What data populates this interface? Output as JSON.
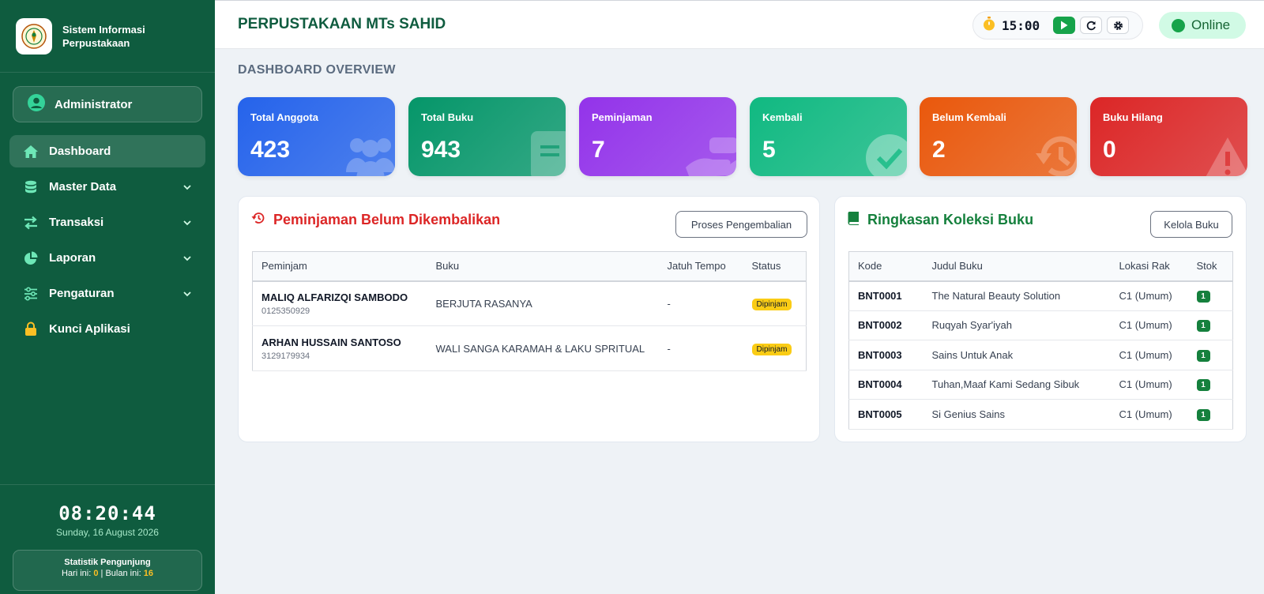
{
  "sidebar": {
    "brand": {
      "line1": "Sistem Informasi",
      "line2": "Perpustakaan"
    },
    "user": "Administrator",
    "menu": [
      {
        "label": "Dashboard",
        "icon": "home-icon",
        "active": true
      },
      {
        "label": "Master Data",
        "icon": "database-icon",
        "expandable": true
      },
      {
        "label": "Transaksi",
        "icon": "exchange-icon",
        "expandable": true
      },
      {
        "label": "Laporan",
        "icon": "pie-chart-icon",
        "expandable": true
      },
      {
        "label": "Pengaturan",
        "icon": "sliders-icon",
        "expandable": true
      },
      {
        "label": "Kunci Aplikasi",
        "icon": "lock-icon"
      }
    ],
    "clock": "08:20:44",
    "date": "Sunday, 16 August 2026",
    "visitor": {
      "title": "Statistik Pengunjung",
      "today_label": "Hari ini:",
      "today": "0",
      "month_label": "Bulan ini:",
      "month": "16"
    }
  },
  "header": {
    "title": "PERPUSTAKAAN MTs SAHID",
    "timer": "15:00",
    "status": "Online"
  },
  "main": {
    "section_title": "DASHBOARD OVERVIEW",
    "cards": [
      {
        "label": "Total Anggota",
        "value": "423",
        "color": "#2563eb"
      },
      {
        "label": "Total Buku",
        "value": "943",
        "color": "#059669"
      },
      {
        "label": "Peminjaman",
        "value": "7",
        "color": "#9333ea"
      },
      {
        "label": "Kembali",
        "value": "5",
        "color": "#10b981"
      },
      {
        "label": "Belum Kembali",
        "value": "2",
        "color": "#ea580c"
      },
      {
        "label": "Buku Hilang",
        "value": "0",
        "color": "#dc2626"
      }
    ],
    "loans": {
      "title": "Peminjaman Belum Dikembalikan",
      "button": "Proses Pengembalian",
      "columns": [
        "Peminjam",
        "Buku",
        "Jatuh Tempo",
        "Status"
      ],
      "rows": [
        {
          "name": "MALIQ ALFARIZQI SAMBODO",
          "id": "0125350929",
          "book": "BERJUTA RASANYA",
          "due": "-",
          "status": "Dipinjam"
        },
        {
          "name": "ARHAN HUSSAIN SANTOSO",
          "id": "3129179934",
          "book": "WALI SANGA KARAMAH & LAKU SPRITUAL",
          "due": "-",
          "status": "Dipinjam"
        }
      ]
    },
    "books": {
      "title": "Ringkasan Koleksi Buku",
      "button": "Kelola Buku",
      "columns": [
        "Kode",
        "Judul Buku",
        "Lokasi Rak",
        "Stok"
      ],
      "rows": [
        {
          "code": "BNT0001",
          "title": "The Natural Beauty Solution",
          "rack": "C1 (Umum)",
          "stock": "1"
        },
        {
          "code": "BNT0002",
          "title": "Ruqyah Syar'iyah",
          "rack": "C1 (Umum)",
          "stock": "1"
        },
        {
          "code": "BNT0003",
          "title": "Sains Untuk Anak",
          "rack": "C1 (Umum)",
          "stock": "1"
        },
        {
          "code": "BNT0004",
          "title": "Tuhan,Maaf Kami Sedang Sibuk",
          "rack": "C1 (Umum)",
          "stock": "1"
        },
        {
          "code": "BNT0005",
          "title": "Si Genius Sains",
          "rack": "C1 (Umum)",
          "stock": "1"
        }
      ]
    }
  }
}
